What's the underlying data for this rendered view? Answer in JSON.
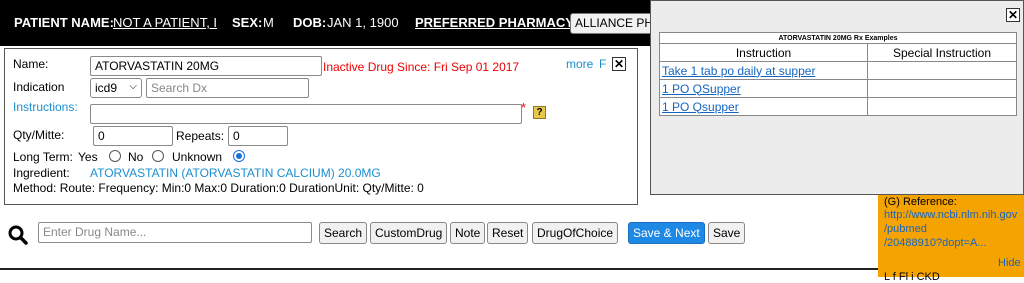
{
  "header": {
    "patient_name_label": "PATIENT NAME:",
    "patient_name_value": "NOT A PATIENT, I",
    "sex_label": "SEX:",
    "sex_value": "M",
    "dob_label": "DOB:",
    "dob_value": "JAN 1, 1900",
    "pharmacy_label": "PREFERRED PHARMACY:",
    "pharmacy_value": "ALLIANCE PH"
  },
  "rx": {
    "name_label": "Name:",
    "name_value": "ATORVASTATIN 20MG",
    "inactive_notice": "Inactive Drug Since: Fri Sep 01 2017",
    "more_link": "more",
    "f_link": "F",
    "close": "✕",
    "indication_label": "Indication",
    "dx_code_select": "icd9",
    "dx_search_placeholder": "Search Dx",
    "instructions_label": "Instructions:",
    "instructions_value": "",
    "required_mark": "*",
    "help_icon": "?",
    "qty_label": "Qty/Mitte:",
    "qty_value": "0",
    "repeats_label": "Repeats:",
    "repeats_value": "0",
    "long_term_label": "Long Term:",
    "long_term_options": [
      "Yes",
      "No",
      "Unknown"
    ],
    "long_term_selected": "Unknown",
    "ingredient_label": "Ingredient:",
    "ingredient_value": "ATORVASTATIN (ATORVASTATIN CALCIUM) 20.0MG",
    "method_line": "Method: Route: Frequency: Min:0 Max:0 Duration:0 DurationUnit: Qty/Mitte: 0"
  },
  "search": {
    "icon": "search-icon",
    "placeholder": "Enter Drug Name...",
    "buttons": [
      "Search",
      "CustomDrug",
      "Note",
      "Reset",
      "DrugOfChoice",
      "Save & Next",
      "Save"
    ]
  },
  "examples_popup": {
    "close": "✕",
    "caption": "ATORVASTATIN 20MG Rx Examples",
    "columns": [
      "Instruction",
      "Special Instruction"
    ],
    "rows": [
      [
        "Take 1 tab po daily at supper",
        ""
      ],
      [
        "1 PO QSupper",
        ""
      ],
      [
        "1 PO Qsupper",
        ""
      ]
    ]
  },
  "side_panel": {
    "reference_label": "(G)  Reference:",
    "reference_link_lines": [
      "http://www.ncbi.nlm.nih.gov",
      "/pubmed",
      "/20488910?dopt=A..."
    ],
    "hide_link": "Hide",
    "bottom_text": "L                        f   Fl  i   CKD"
  },
  "colors": {
    "header_bg": "#000000",
    "link_blue": "#1a8fce",
    "error_red": "#ee0000",
    "primary_button": "#1e88e5",
    "side_panel_bg": "#f5a300"
  }
}
